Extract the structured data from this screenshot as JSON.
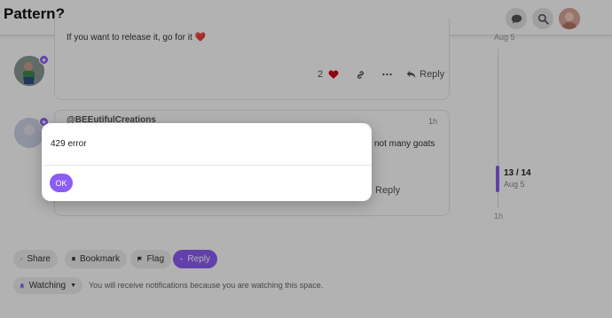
{
  "header": {
    "title": "Pattern?",
    "icons": [
      "chat-icon",
      "search-icon",
      "user-avatar"
    ]
  },
  "posts": [
    {
      "text": "If you want to release it, go for it",
      "like_count": "2",
      "reply_label": "Reply"
    },
    {
      "username": "@BEEutifulCreations",
      "time": "1h",
      "text_fragment": "not many goats",
      "reply_label": "Reply"
    }
  ],
  "timeline": {
    "top_date": "Aug 5",
    "position": "13 / 14",
    "position_date": "Aug 5",
    "bottom_label": "1h",
    "progress": 0.93
  },
  "footer": {
    "share_label": "Share",
    "bookmark_label": "Bookmark",
    "flag_label": "Flag",
    "reply_label": "Reply",
    "watching_label": "Watching",
    "watching_note": "You will receive notifications because you are watching this space."
  },
  "modal": {
    "message": "429 error",
    "ok_label": "OK"
  },
  "colors": {
    "accent": "#8b5cf6",
    "heart": "#d0021b"
  }
}
